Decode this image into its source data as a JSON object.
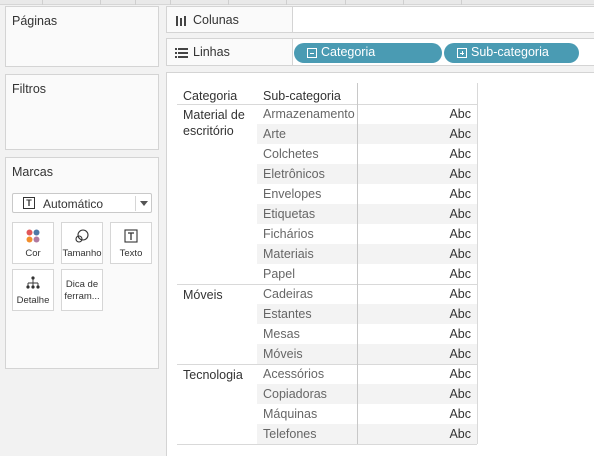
{
  "left_panel": {
    "pages_title": "Páginas",
    "filters_title": "Filtros",
    "marks": {
      "title": "Marcas",
      "mark_type": "Automático",
      "buttons": {
        "color": "Cor",
        "size": "Tamanho",
        "text": "Texto",
        "detail": "Detalhe",
        "tooltip_line1": "Dica de",
        "tooltip_line2": "ferram..."
      }
    }
  },
  "shelves": {
    "columns_label": "Colunas",
    "rows_label": "Linhas",
    "row_pills": [
      "Categoria",
      "Sub-categoria"
    ]
  },
  "view": {
    "header_category": "Categoria",
    "header_subcategory": "Sub-categoria",
    "categories": [
      {
        "label_line1": "Material de",
        "label_line2": "escritório",
        "subs": [
          "Armazenamento",
          "Arte",
          "Colchetes",
          "Eletrônicos",
          "Envelopes",
          "Etiquetas",
          "Fichários",
          "Materiais",
          "Papel"
        ]
      },
      {
        "label_line1": "Móveis",
        "label_line2": "",
        "subs": [
          "Cadeiras",
          "Estantes",
          "Mesas",
          "Móveis"
        ]
      },
      {
        "label_line1": "Tecnologia",
        "label_line2": "",
        "subs": [
          "Acessórios",
          "Copiadoras",
          "Máquinas",
          "Telefones"
        ]
      }
    ],
    "cell_text": "Abc"
  },
  "colors": {
    "pill": "#4a9bb3",
    "band": "#f3f3f3",
    "panel_bg": "#f2f2f2"
  }
}
